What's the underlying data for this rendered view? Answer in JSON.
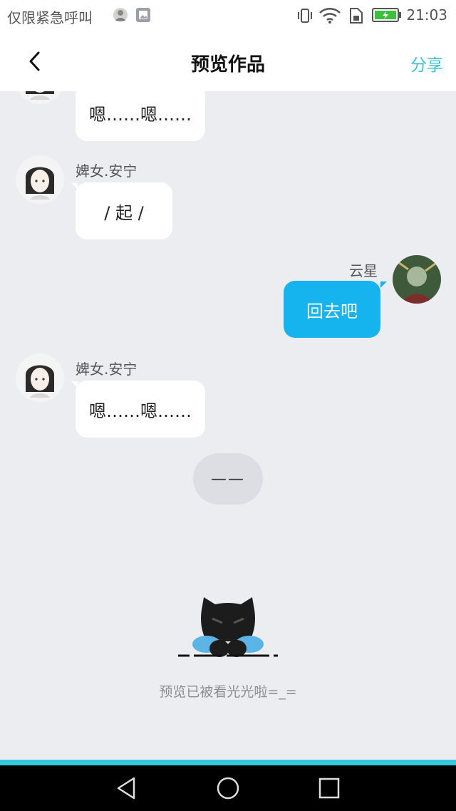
{
  "status_bar": {
    "left_text": "仅限紧急呼叫",
    "time": "21:03",
    "icons": [
      "user-thumbnail-icon",
      "image-icon",
      "vibrate-icon",
      "wifi-icon",
      "sim-icon",
      "battery-charging-icon"
    ]
  },
  "header": {
    "back_icon": "chevron-left-icon",
    "title": "预览作品",
    "share_label": "分享"
  },
  "messages": [
    {
      "sender": "",
      "side": "left",
      "text": "嗯……嗯……"
    },
    {
      "sender": "婢女.安宁",
      "side": "left",
      "text": "/ 起 /"
    },
    {
      "sender": "云星",
      "side": "right",
      "text": "回去吧"
    },
    {
      "sender": "婢女.安宁",
      "side": "left",
      "text": "嗯……嗯……"
    }
  ],
  "divider_text": "——",
  "end": {
    "mascot_icon": "peeking-cat-icon",
    "caption": "预览已被看光光啦=_="
  },
  "nav_bar": [
    "back-triangle-icon",
    "home-circle-icon",
    "recents-square-icon"
  ],
  "colors": {
    "accent": "#36c3d8",
    "bubble_self": "#16b4ee",
    "bubble_other": "#ffffff",
    "background": "#ebedf0"
  }
}
